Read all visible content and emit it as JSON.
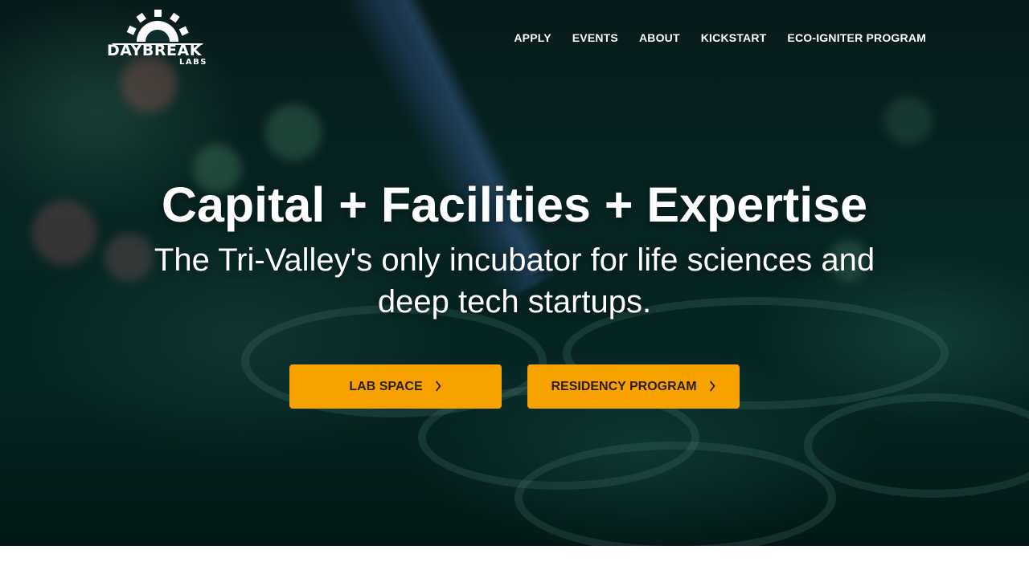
{
  "logo": {
    "name": "DAYBREAK",
    "sub": "LABS"
  },
  "nav": [
    {
      "label": "APPLY"
    },
    {
      "label": "EVENTS"
    },
    {
      "label": "ABOUT"
    },
    {
      "label": "KICKSTART"
    },
    {
      "label": "ECO-IGNITER PROGRAM"
    }
  ],
  "hero": {
    "title": "Capital + Facilities + Expertise",
    "subtitle": "The Tri-Valley's only incubator for life sciences and deep tech startups."
  },
  "buttons": {
    "lab_space": "LAB SPACE",
    "residency": "RESIDENCY PROGRAM"
  },
  "colors": {
    "accent": "#f8a200",
    "button_text": "#2a1e0a",
    "hero_tint": "#0a3a34"
  },
  "icons": {
    "button_chevron": "chevron-right-icon",
    "logo_gear": "gear-icon"
  }
}
